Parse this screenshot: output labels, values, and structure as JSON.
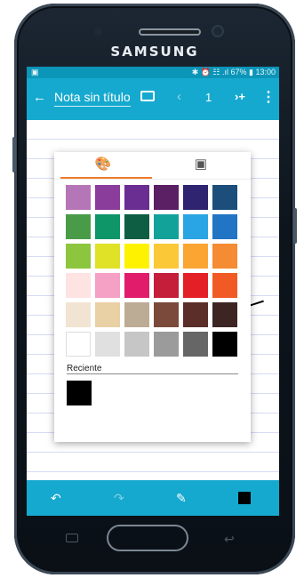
{
  "device": {
    "brand": "SAMSUNG"
  },
  "status_bar": {
    "left_icon": "notification-icon",
    "right_text": "✱ ⏰ ☷ .ıl 67% ▮ 13:00"
  },
  "app_bar": {
    "back_icon": "←",
    "title": "Nota sin título",
    "cast_icon": "cast-icon",
    "prev_icon": "‹",
    "page_number": "1",
    "next_icon": "›+",
    "more_icon": "⋮"
  },
  "popup": {
    "tabs": [
      {
        "icon": "palette-icon",
        "glyph": "🎨"
      },
      {
        "icon": "custom-color-icon",
        "glyph": "▣"
      }
    ],
    "active_tab": 0,
    "accent_color": "#f07a2a",
    "colors": [
      [
        "#b576b8",
        "#8b3d9c",
        "#6a2d91",
        "#5b1f63",
        "#2e2470",
        "#1b4e7b"
      ],
      [
        "#4a9b47",
        "#0e9568",
        "#0d5e42",
        "#13a29a",
        "#2aa5e3",
        "#2274c4"
      ],
      [
        "#8cc63e",
        "#dfe227",
        "#fff200",
        "#fbc838",
        "#fba533",
        "#f58b32"
      ],
      [
        "#fde3e2",
        "#f5a0c5",
        "#e11d6b",
        "#c41e3a",
        "#e42027",
        "#f15a24"
      ],
      [
        "#f1e4d2",
        "#e9d0a5",
        "#bcab95",
        "#7b4a3a",
        "#5b2e2a",
        "#3d2523"
      ],
      [
        "#ffffff",
        "#e0e0e0",
        "#c6c6c6",
        "#9b9b9b",
        "#666666",
        "#000000"
      ]
    ],
    "recent_label": "Reciente",
    "recent_colors": [
      "#000000"
    ]
  },
  "bottom_bar": {
    "undo_icon": "↶",
    "redo_icon": "↷",
    "pen_icon": "✎",
    "current_color": "#000000"
  }
}
